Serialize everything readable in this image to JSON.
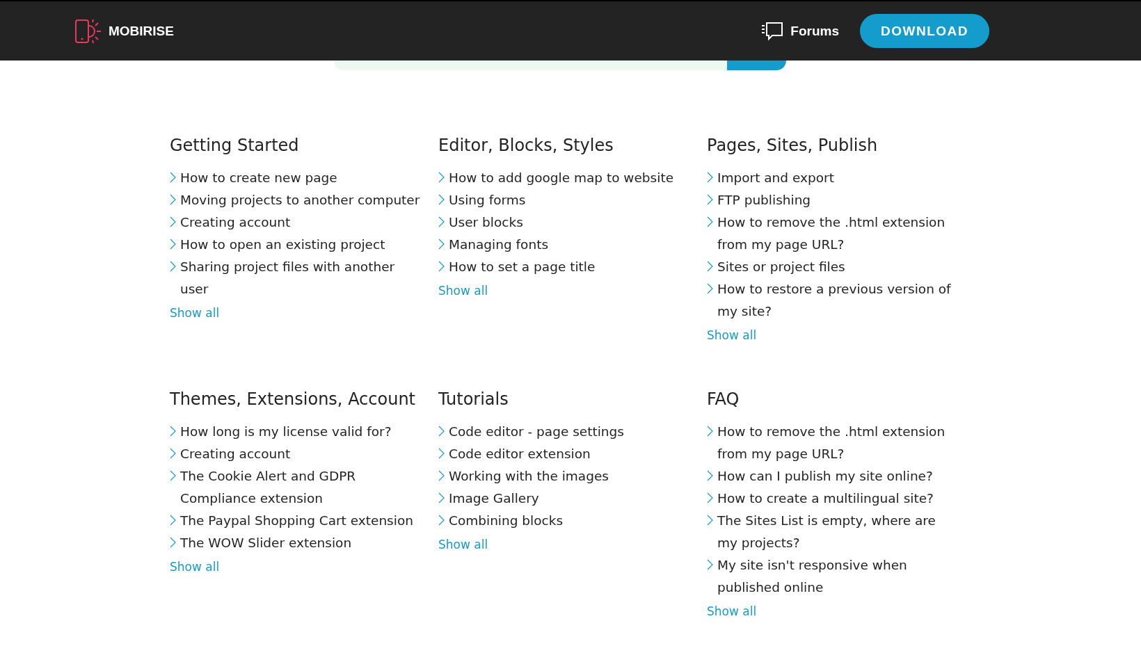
{
  "header": {
    "logo": "MOBIRISE",
    "forums": "Forums",
    "download": "DOWNLOAD"
  },
  "sections": [
    {
      "title": "Getting Started",
      "items": [
        "How to create new page",
        "Moving projects to another computer",
        "Creating account",
        "How to open an existing project",
        "Sharing project files with another user"
      ],
      "show_all": "Show all"
    },
    {
      "title": "Editor, Blocks, Styles",
      "items": [
        "How to add google map to website",
        "Using forms",
        "User blocks",
        "Managing fonts",
        "How to set a page title"
      ],
      "show_all": "Show all"
    },
    {
      "title": "Pages, Sites, Publish",
      "items": [
        "Import and export",
        "FTP publishing",
        "How to remove the .html extension from my page URL?",
        "Sites or project files",
        "How to restore a previous version of my site?"
      ],
      "show_all": "Show all"
    },
    {
      "title": "Themes, Extensions, Account",
      "items": [
        "How long is my license valid for?",
        "Creating account",
        "The Cookie Alert and GDPR Compliance extension",
        "The Paypal Shopping Cart extension",
        "The WOW Slider extension"
      ],
      "show_all": "Show all"
    },
    {
      "title": "Tutorials",
      "items": [
        "Code editor - page settings",
        "Code editor extension",
        "Working with the images",
        "Image Gallery",
        "Combining blocks"
      ],
      "show_all": "Show all"
    },
    {
      "title": "FAQ",
      "items": [
        "How to remove the .html extension from my page URL?",
        "How can I publish my site online?",
        "How to create a multilingual site?",
        "The Sites List is empty, where are my projects?",
        "My site isn't responsive when published online"
      ],
      "show_all": "Show all"
    }
  ]
}
